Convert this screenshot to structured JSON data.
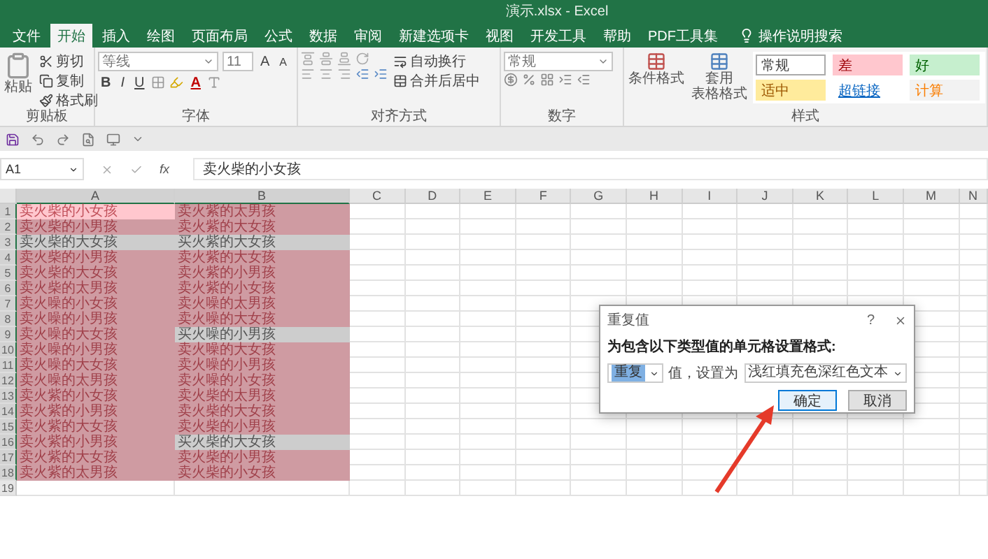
{
  "window": {
    "title": "演示.xlsx - Excel"
  },
  "ribbon_tabs": [
    {
      "label": "文件",
      "selected": false
    },
    {
      "label": "开始",
      "selected": true
    },
    {
      "label": "插入",
      "selected": false
    },
    {
      "label": "绘图",
      "selected": false
    },
    {
      "label": "页面布局",
      "selected": false
    },
    {
      "label": "公式",
      "selected": false
    },
    {
      "label": "数据",
      "selected": false
    },
    {
      "label": "审阅",
      "selected": false
    },
    {
      "label": "新建选项卡",
      "selected": false
    },
    {
      "label": "视图",
      "selected": false
    },
    {
      "label": "开发工具",
      "selected": false
    },
    {
      "label": "帮助",
      "selected": false
    },
    {
      "label": "PDF工具集",
      "selected": false
    }
  ],
  "tell_me": "操作说明搜索",
  "clipboard": {
    "label": "剪贴板",
    "paste": "粘贴",
    "cut": "剪切",
    "copy": "复制",
    "format_painter": "格式刷"
  },
  "font": {
    "label": "字体",
    "font_name": "等线",
    "font_size": "11",
    "size_buttons": [
      "A",
      "A"
    ],
    "style_buttons": [
      "B",
      "I",
      "U"
    ],
    "font_color": "A"
  },
  "alignment": {
    "label": "对齐方式",
    "wrap_text": "自动换行",
    "merge_center": "合并后居中"
  },
  "number": {
    "label": "数字",
    "format": "常规"
  },
  "styles": {
    "label": "样式",
    "conditional_formatting": "条件格式",
    "format_as_table": [
      "套用",
      "表格格式"
    ],
    "cell_styles": [
      {
        "label": "常规",
        "kind": "normal"
      },
      {
        "label": "差",
        "kind": "bad"
      },
      {
        "label": "好",
        "kind": "good"
      },
      {
        "label": "适中",
        "kind": "neutral"
      },
      {
        "label": "超链接",
        "kind": "hyperlink"
      },
      {
        "label": "计算",
        "kind": "calculation"
      }
    ]
  },
  "name_box": "A1",
  "fx": "fx",
  "formula": "卖火柴的小女孩",
  "columns": [
    {
      "label": "A",
      "selected": true
    },
    {
      "label": "B",
      "selected": true
    },
    {
      "label": "C",
      "selected": false
    },
    {
      "label": "D",
      "selected": false
    },
    {
      "label": "E",
      "selected": false
    },
    {
      "label": "F",
      "selected": false
    },
    {
      "label": "G",
      "selected": false
    },
    {
      "label": "H",
      "selected": false
    },
    {
      "label": "I",
      "selected": false
    },
    {
      "label": "J",
      "selected": false
    },
    {
      "label": "K",
      "selected": false
    },
    {
      "label": "L",
      "selected": false
    },
    {
      "label": "M",
      "selected": false
    },
    {
      "label": "N",
      "selected": false
    }
  ],
  "rows": [
    {
      "number": "1",
      "selected": true,
      "cells": [
        {
          "text": "卖火柴的小女孩",
          "duplicate": true,
          "selected": true
        },
        {
          "text": "卖火紫的太男孩",
          "duplicate": true,
          "selected": false
        }
      ]
    },
    {
      "number": "2",
      "selected": true,
      "cells": [
        {
          "text": "卖火柴的小男孩",
          "duplicate": true,
          "selected": false
        },
        {
          "text": "卖火紫的大女孩",
          "duplicate": true,
          "selected": false
        }
      ]
    },
    {
      "number": "3",
      "selected": true,
      "cells": [
        {
          "text": "卖火柴的大女孩",
          "duplicate": false,
          "selected": false
        },
        {
          "text": "买火紫的大女孩",
          "duplicate": false,
          "selected": false
        }
      ]
    },
    {
      "number": "4",
      "selected": true,
      "cells": [
        {
          "text": "卖火柴的小男孩",
          "duplicate": true,
          "selected": false
        },
        {
          "text": "卖火紫的大女孩",
          "duplicate": true,
          "selected": false
        }
      ]
    },
    {
      "number": "5",
      "selected": true,
      "cells": [
        {
          "text": "卖火柴的大女孩",
          "duplicate": true,
          "selected": false
        },
        {
          "text": "卖火紫的小男孩",
          "duplicate": true,
          "selected": false
        }
      ]
    },
    {
      "number": "6",
      "selected": true,
      "cells": [
        {
          "text": "卖火柴的太男孩",
          "duplicate": true,
          "selected": false
        },
        {
          "text": "卖火紫的小女孩",
          "duplicate": true,
          "selected": false
        }
      ]
    },
    {
      "number": "7",
      "selected": true,
      "cells": [
        {
          "text": "卖火噪的小女孩",
          "duplicate": true,
          "selected": false
        },
        {
          "text": "卖火噪的太男孩",
          "duplicate": true,
          "selected": false
        }
      ]
    },
    {
      "number": "8",
      "selected": true,
      "cells": [
        {
          "text": "卖火噪的小男孩",
          "duplicate": true,
          "selected": false
        },
        {
          "text": "卖火噪的大女孩",
          "duplicate": true,
          "selected": false
        }
      ]
    },
    {
      "number": "9",
      "selected": true,
      "cells": [
        {
          "text": "卖火噪的大女孩",
          "duplicate": true,
          "selected": false
        },
        {
          "text": "买火噪的小男孩",
          "duplicate": false,
          "selected": false
        }
      ]
    },
    {
      "number": "10",
      "selected": true,
      "cells": [
        {
          "text": "卖火噪的小男孩",
          "duplicate": true,
          "selected": false
        },
        {
          "text": "卖火噪的大女孩",
          "duplicate": true,
          "selected": false
        }
      ]
    },
    {
      "number": "11",
      "selected": true,
      "cells": [
        {
          "text": "卖火噪的大女孩",
          "duplicate": true,
          "selected": false
        },
        {
          "text": "卖火噪的小男孩",
          "duplicate": true,
          "selected": false
        }
      ]
    },
    {
      "number": "12",
      "selected": true,
      "cells": [
        {
          "text": "卖火噪的太男孩",
          "duplicate": true,
          "selected": false
        },
        {
          "text": "卖火噪的小女孩",
          "duplicate": true,
          "selected": false
        }
      ]
    },
    {
      "number": "13",
      "selected": true,
      "cells": [
        {
          "text": "卖火紫的小女孩",
          "duplicate": true,
          "selected": false
        },
        {
          "text": "卖火柴的太男孩",
          "duplicate": true,
          "selected": false
        }
      ]
    },
    {
      "number": "14",
      "selected": true,
      "cells": [
        {
          "text": "卖火紫的小男孩",
          "duplicate": true,
          "selected": false
        },
        {
          "text": "卖火柴的大女孩",
          "duplicate": true,
          "selected": false
        }
      ]
    },
    {
      "number": "15",
      "selected": true,
      "cells": [
        {
          "text": "卖火紫的大女孩",
          "duplicate": true,
          "selected": false
        },
        {
          "text": "卖火柴的小男孩",
          "duplicate": true,
          "selected": false
        }
      ]
    },
    {
      "number": "16",
      "selected": true,
      "cells": [
        {
          "text": "卖火紫的小男孩",
          "duplicate": true,
          "selected": false
        },
        {
          "text": "买火柴的大女孩",
          "duplicate": false,
          "selected": false
        }
      ]
    },
    {
      "number": "17",
      "selected": true,
      "cells": [
        {
          "text": "卖火紫的大女孩",
          "duplicate": true,
          "selected": false
        },
        {
          "text": "卖火柴的小男孩",
          "duplicate": true,
          "selected": false
        }
      ]
    },
    {
      "number": "18",
      "selected": true,
      "cells": [
        {
          "text": "卖火紫的太男孩",
          "duplicate": true,
          "selected": false
        },
        {
          "text": "卖火柴的小女孩",
          "duplicate": true,
          "selected": false
        }
      ]
    },
    {
      "number": "19",
      "selected": false,
      "cells": []
    }
  ],
  "dialog": {
    "title": "重复值",
    "help": "?",
    "prompt": "为包含以下类型值的单元格设置格式:",
    "rule": "重复",
    "middle_label": "值，设置为",
    "format": "浅红填充色深红色文本",
    "buttons": [
      {
        "label": "确定",
        "focused": true
      },
      {
        "label": "取消",
        "focused": false
      }
    ]
  }
}
